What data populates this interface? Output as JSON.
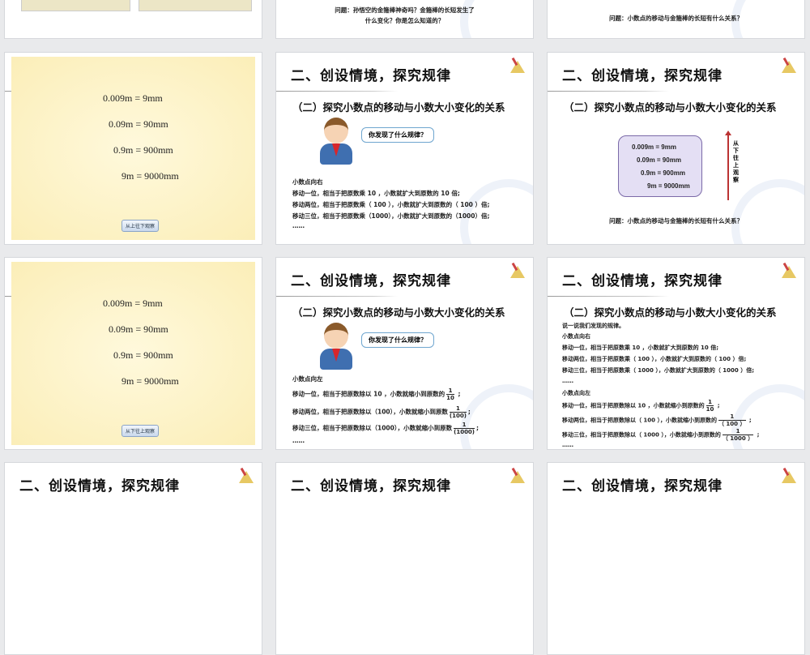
{
  "common": {
    "title": "二、创设情境，探究规律",
    "subtitle": "（二）探究小数点的移动与小数大小变化的关系"
  },
  "equations": [
    "0.009m = 9mm",
    "0.09m = 90mm",
    "0.9m = 900mm",
    "9m = 9000mm"
  ],
  "row1": {
    "q2_line1": "问题：孙悟空的金箍棒神奇吗？金箍棒的长短发生了",
    "q2_line2": "什么变化？你是怎么知道的？",
    "q3": "问题：小数点的移动与金箍棒的长短有什么关系？"
  },
  "slide_a": {
    "button": "从上往下观察"
  },
  "slide_b": {
    "bubble": "你发现了什么规律？",
    "lines": [
      "小数点向右",
      "移动一位，相当于把原数乘 10 ，小数就扩大到原数的 10 倍;",
      "移动两位，相当于把原数乘（ 100 ），小数就扩大到原数的（ 100 ）倍;",
      "移动三位，相当于把原数乘（1000），小数就扩大到原数的（1000）倍;",
      "……"
    ]
  },
  "slide_c": {
    "vertical": "从下往上观察",
    "question": "问题：小数点的移动与金箍棒的长短有什么关系？"
  },
  "slide_d": {
    "button": "从下往上观察"
  },
  "slide_e": {
    "bubble": "你发现了什么规律？",
    "head": "小数点向左",
    "l1": "移动一位，相当于把原数除以 10 ，小数就缩小到原数的",
    "l2": "移动两位，相当于把原数除以（100），小数就缩小到原数",
    "l3": "移动三位，相当于把原数除以（1000），小数就缩小到原数",
    "dots": "……",
    "f1": [
      "1",
      "10"
    ],
    "f2": [
      "1",
      "(100)"
    ],
    "f3": [
      "1",
      "(1000)"
    ]
  },
  "slide_f": {
    "intro": "说一说我们发现的规律。",
    "r": [
      "小数点向右",
      "移动一位，相当于把原数乘 10 ，小数就扩大到原数的 10 倍;",
      "移动两位，相当于把原数乘（ 100 ），小数就扩大到原数的（ 100 ）倍;",
      "移动三位，相当于把原数乘（ 1000 ），小数就扩大到原数的（ 1000 ）倍;",
      "……"
    ],
    "lhead": "小数点向左",
    "l1": "移动一位，相当于把原数除以 10 ，小数就缩小到原数的",
    "l2": "移动两位，相当于把原数除以（ 100 ），小数就缩小到原数的",
    "l3": "移动三位，相当于把原数除以（ 1000 ），小数就缩小到原数的",
    "dots": "……",
    "f1": [
      "1",
      "10"
    ],
    "f2": [
      "1",
      "（ 100 ）"
    ],
    "f3": [
      "1",
      "（ 1000 ）"
    ]
  }
}
